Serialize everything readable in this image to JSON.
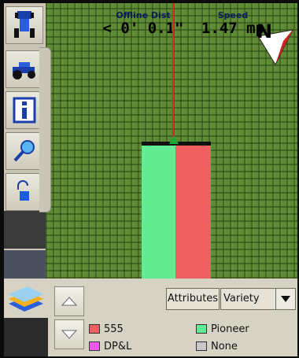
{
  "readouts": {
    "offline": {
      "label": "Offline Dist",
      "value": "< 0' 0.1\""
    },
    "speed": {
      "label": "Speed",
      "value": "1.47 mp"
    }
  },
  "compass": {
    "letter": "N"
  },
  "toolbar": {
    "icons": [
      "tractor-top-icon",
      "tractor-icon",
      "info-icon",
      "zoom-icon",
      "unlock-icon"
    ]
  },
  "strips": [
    {
      "name": "Pioneer",
      "color": "#62ec94"
    },
    {
      "name": "555",
      "color": "#f06060"
    }
  ],
  "panel": {
    "attributes_label": "Attributes",
    "selected_attribute": "Variety",
    "legend": [
      {
        "label": "555",
        "color": "#f06060"
      },
      {
        "label": "Pioneer",
        "color": "#62ec94"
      },
      {
        "label": "DP&L",
        "color": "#ee58e8"
      },
      {
        "label": "None",
        "color": "#c8c8c8"
      }
    ]
  },
  "colors": {
    "field": "#5f8a35",
    "guidance_line": "#d83020",
    "heading_arrow": "#18a83a"
  }
}
